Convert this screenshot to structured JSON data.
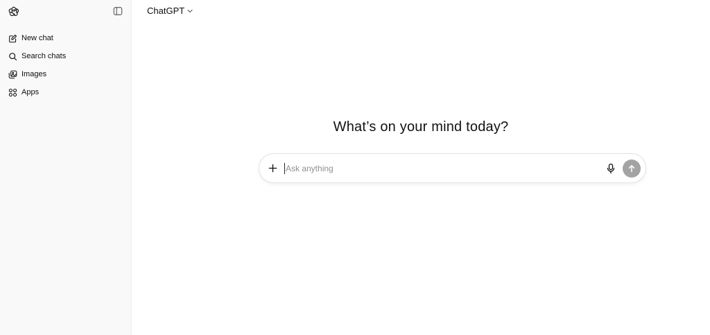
{
  "sidebar": {
    "items": [
      {
        "label": "New chat",
        "icon": "edit-icon"
      },
      {
        "label": "Search chats",
        "icon": "search-icon"
      },
      {
        "label": "Images",
        "icon": "images-icon"
      },
      {
        "label": "Apps",
        "icon": "apps-icon"
      }
    ]
  },
  "header": {
    "model_label": "ChatGPT"
  },
  "main": {
    "heading": "What’s on your mind today?",
    "composer": {
      "placeholder": "Ask anything",
      "value": ""
    }
  },
  "colors": {
    "sidebar_bg": "#f9f9f9",
    "send_button": "#a3a3a3",
    "text": "#0d0d0d",
    "placeholder": "#8f8f8f"
  }
}
